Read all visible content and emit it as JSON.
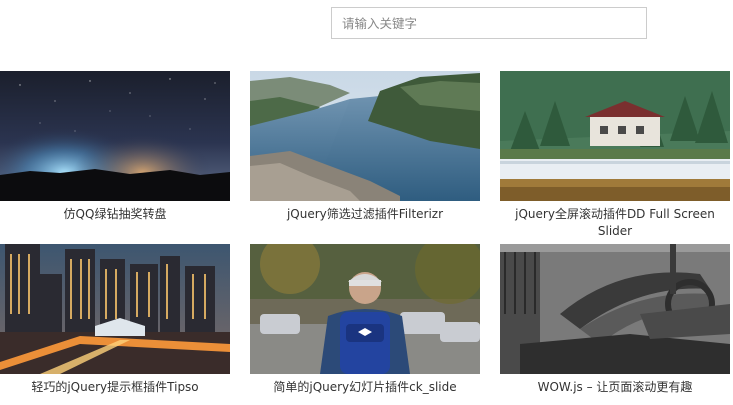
{
  "search": {
    "placeholder": "请输入关键字",
    "value": ""
  },
  "plugins": [
    {
      "title": "仿QQ绿钻抽奖转盘"
    },
    {
      "title": "jQuery筛选过滤插件Filterizr"
    },
    {
      "title": "jQuery全屏滚动插件DD Full Screen Slider"
    },
    {
      "title": "轻巧的jQuery提示框插件Tipso"
    },
    {
      "title": "简单的jQuery幻灯片插件ck_slide"
    },
    {
      "title": "WOW.js – 让页面滚动更有趣"
    }
  ]
}
